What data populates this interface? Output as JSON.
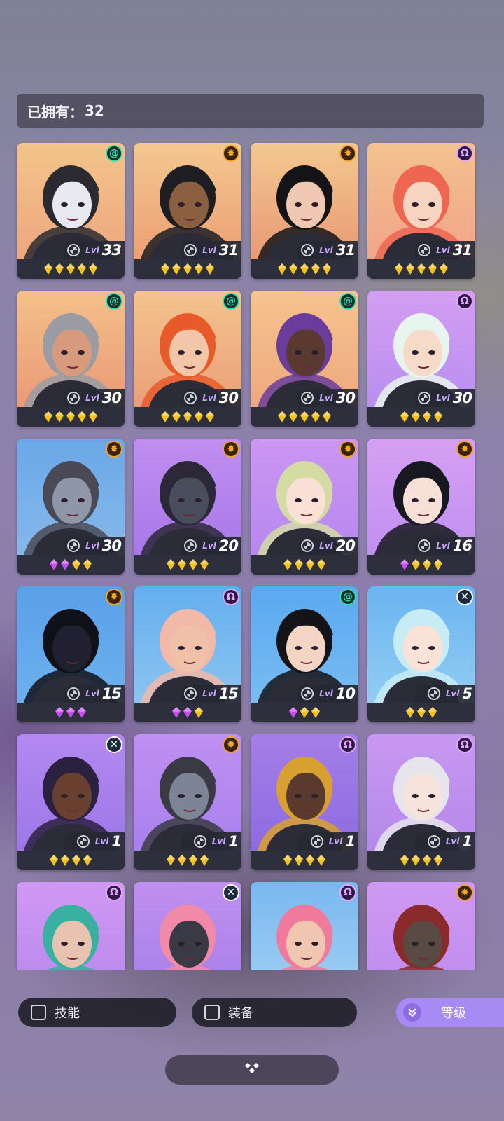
{
  "header": {
    "owned_label": "已拥有：",
    "owned_count": "32"
  },
  "lvl_prefix": "Lvl",
  "heroes": [
    {
      "level": "33",
      "class": "nature",
      "gems": [
        "gold",
        "gold",
        "gold",
        "gold",
        "gold"
      ],
      "bg": [
        "#f3c48b",
        "#eea77e"
      ],
      "tone": "#e8e8f0",
      "hair": "#2a2a30"
    },
    {
      "level": "31",
      "class": "order",
      "gems": [
        "gold",
        "gold",
        "gold",
        "gold",
        "gold"
      ],
      "bg": [
        "#f4c890",
        "#ec9f73"
      ],
      "tone": "#8a6040",
      "hair": "#1d1d22"
    },
    {
      "level": "31",
      "class": "order",
      "gems": [
        "gold",
        "gold",
        "gold",
        "gold",
        "gold"
      ],
      "bg": [
        "#f4c890",
        "#e89a74"
      ],
      "tone": "#f0c7b0",
      "hair": "#141418"
    },
    {
      "level": "31",
      "class": "mystic",
      "gems": [
        "gold",
        "gold",
        "gold",
        "gold",
        "gold"
      ],
      "bg": [
        "#f3c28e",
        "#f2a48a"
      ],
      "tone": "#f6d4c0",
      "hair": "#ef6650"
    },
    {
      "level": "30",
      "class": "nature",
      "gems": [
        "gold",
        "gold",
        "gold",
        "gold",
        "gold"
      ],
      "bg": [
        "#f4c08a",
        "#e99a76"
      ],
      "tone": "#d89a7c",
      "hair": "#9b9ba4"
    },
    {
      "level": "30",
      "class": "nature",
      "gems": [
        "gold",
        "gold",
        "gold",
        "gold",
        "gold"
      ],
      "bg": [
        "#f4c48e",
        "#e99f78"
      ],
      "tone": "#f2c6a8",
      "hair": "#e85a2a"
    },
    {
      "level": "30",
      "class": "nature",
      "gems": [
        "gold",
        "gold",
        "gold",
        "gold",
        "gold"
      ],
      "bg": [
        "#f6c48e",
        "#eea87e"
      ],
      "tone": "#5a3a30",
      "hair": "#6a3c9c"
    },
    {
      "level": "30",
      "class": "mystic",
      "gems": [
        "gold",
        "gold",
        "gold",
        "gold"
      ],
      "bg": [
        "#d49ef2",
        "#b88ef0"
      ],
      "tone": "#f6dcc8",
      "hair": "#e8f4ee"
    },
    {
      "level": "30",
      "class": "order",
      "gems": [
        "purple",
        "purple",
        "gold",
        "gold"
      ],
      "bg": [
        "#6aa8e8",
        "#86b8ea"
      ],
      "tone": "#8e96a8",
      "hair": "#4a4a56"
    },
    {
      "level": "20",
      "class": "order",
      "gems": [
        "gold",
        "gold",
        "gold",
        "gold"
      ],
      "bg": [
        "#c08ef0",
        "#a878e8"
      ],
      "tone": "#4a4e5c",
      "hair": "#2c2838"
    },
    {
      "level": "20",
      "class": "order",
      "gems": [
        "gold",
        "gold",
        "gold",
        "gold"
      ],
      "bg": [
        "#cc96f2",
        "#b688f0"
      ],
      "tone": "#fbe0d6",
      "hair": "#d4dca4"
    },
    {
      "level": "16",
      "class": "order",
      "gems": [
        "purple",
        "gold",
        "gold",
        "gold"
      ],
      "bg": [
        "#d6a0f4",
        "#c090f0"
      ],
      "tone": "#f8e0d8",
      "hair": "#181820"
    },
    {
      "level": "15",
      "class": "order",
      "gems": [
        "purple",
        "purple",
        "purple"
      ],
      "bg": [
        "#5aa0e8",
        "#6cb0ee"
      ],
      "tone": "#202030",
      "hair": "#101018"
    },
    {
      "level": "15",
      "class": "mystic",
      "gems": [
        "purple",
        "purple",
        "gold"
      ],
      "bg": [
        "#64aeee",
        "#8cc4f0"
      ],
      "tone": "#f0c0a8",
      "hair": "#f2b8a8"
    },
    {
      "level": "10",
      "class": "nature",
      "gems": [
        "purple",
        "gold",
        "gold"
      ],
      "bg": [
        "#5aa8f0",
        "#78bcf2"
      ],
      "tone": "#f4d4c4",
      "hair": "#141418"
    },
    {
      "level": "5",
      "class": "chaos",
      "gems": [
        "gold",
        "gold",
        "gold"
      ],
      "bg": [
        "#6ab4f0",
        "#92ccf4"
      ],
      "tone": "#fbe2d6",
      "hair": "#c8ecf4"
    },
    {
      "level": "1",
      "class": "chaos",
      "gems": [
        "gold",
        "gold",
        "gold",
        "gold"
      ],
      "bg": [
        "#b488f0",
        "#9c78e8"
      ],
      "tone": "#6a4030",
      "hair": "#2a2040"
    },
    {
      "level": "1",
      "class": "order",
      "gems": [
        "gold",
        "gold",
        "gold",
        "gold"
      ],
      "bg": [
        "#c090f2",
        "#a880ec"
      ],
      "tone": "#7c8496",
      "hair": "#3a3a44"
    },
    {
      "level": "1",
      "class": "mystic",
      "gems": [
        "gold",
        "gold",
        "gold",
        "gold"
      ],
      "bg": [
        "#a47ee8",
        "#8c6ce0"
      ],
      "tone": "#5a3a2c",
      "hair": "#d8a030"
    },
    {
      "level": "1",
      "class": "mystic",
      "gems": [
        "gold",
        "gold",
        "gold",
        "gold"
      ],
      "bg": [
        "#c898f0",
        "#b488ec"
      ],
      "tone": "#f6e4dc",
      "hair": "#e6e4ec"
    },
    {
      "level": "",
      "class": "mystic",
      "gems": [],
      "bg": [
        "#d098f2",
        "#b888ee"
      ],
      "tone": "#e8c4b0",
      "hair": "#3ab0a0"
    },
    {
      "level": "",
      "class": "chaos",
      "gems": [],
      "bg": [
        "#c090f0",
        "#a47ee8"
      ],
      "tone": "#3a3a46",
      "hair": "#f08aa8"
    },
    {
      "level": "",
      "class": "mystic",
      "gems": [],
      "bg": [
        "#7ab8f0",
        "#a0d0f4"
      ],
      "tone": "#f0c6b0",
      "hair": "#f07a9c"
    },
    {
      "level": "",
      "class": "order",
      "gems": [],
      "bg": [
        "#d098f2",
        "#bc8cee"
      ],
      "tone": "#5a4a44",
      "hair": "#8a2a2a"
    }
  ],
  "class_glyphs": {
    "nature": "@",
    "order": "✸",
    "mystic": "Ω",
    "chaos": "✕"
  },
  "filters": {
    "skill_label": "技能",
    "equip_label": "装备"
  },
  "sort": {
    "label": "等级",
    "icon": "chevrons-down-icon"
  },
  "colors": {
    "accent": "#a88af4",
    "gem_gold": "#f5c21b",
    "gem_purple": "#c84cf0"
  }
}
